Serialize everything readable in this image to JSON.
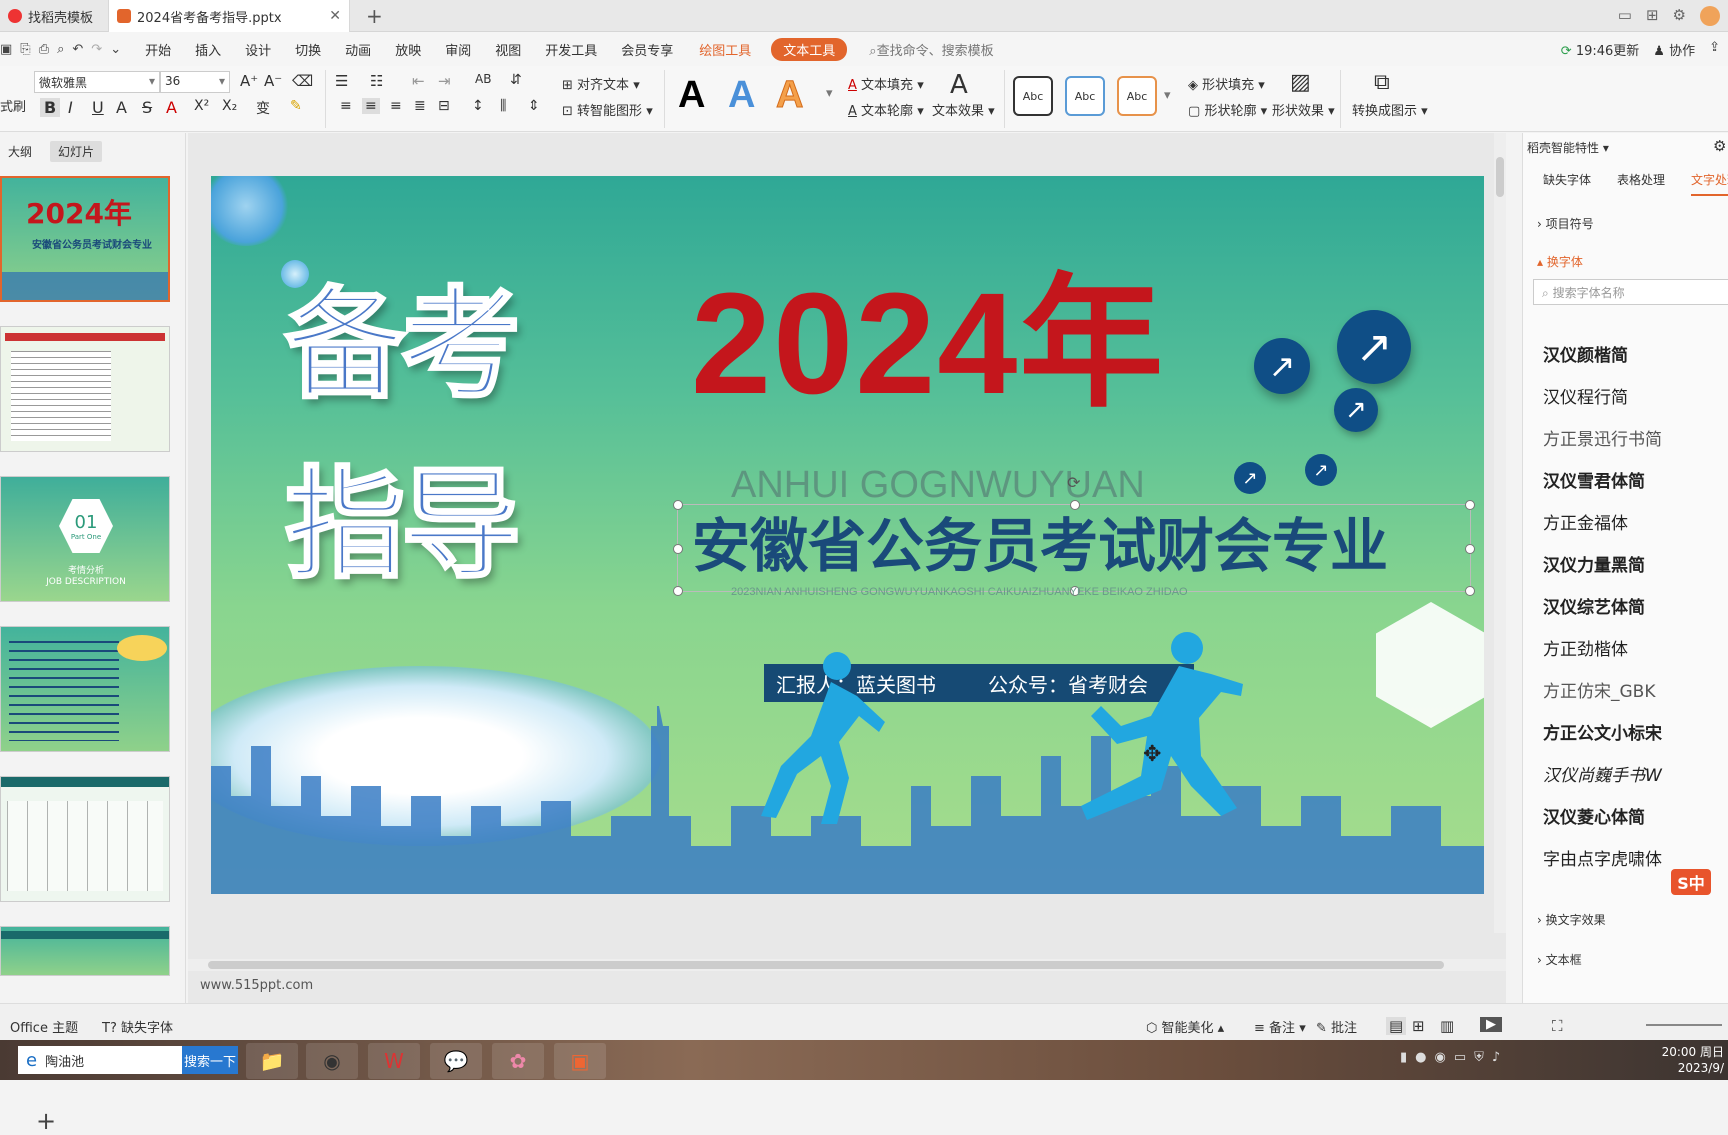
{
  "tabs": {
    "tab1": "找稻壳模板",
    "tab2": "2024省考备考指导.pptx"
  },
  "menu": {
    "items": [
      "开始",
      "插入",
      "设计",
      "切换",
      "动画",
      "放映",
      "审阅",
      "视图",
      "开发工具",
      "会员专享"
    ],
    "drawing_tools": "绘图工具",
    "text_tools": "文本工具",
    "search_placeholder": "查找命令、搜索模板",
    "update": "19:46更新",
    "collab": "协作"
  },
  "ribbon": {
    "brush": "式刷",
    "font_name": "微软雅黑",
    "font_size": "36",
    "align_text": "对齐文本",
    "smart_shape": "转智能图形",
    "text_fill": "文本填充",
    "text_outline": "文本轮廓",
    "text_effect": "文本效果",
    "abc": "Abc",
    "shape_fill": "形状填充",
    "shape_outline": "形状轮廓",
    "shape_effect": "形状效果",
    "convert_diagram": "转换成图示"
  },
  "left_panel": {
    "outline": "大纲",
    "slides": "幻灯片",
    "add": "+"
  },
  "slide": {
    "title1": "备考",
    "title2": "指导",
    "year": "2024年",
    "pinyin": "ANHUI GOGNWUYUAN",
    "subtitle": "安徽省公务员考试财会专业",
    "small_pinyin": "2023NIAN ANHUISHENG GONGWUYUANKAOSHI CAIKUAIZHUANYEKE BEIKAO ZHIDAO",
    "reporter": "汇报人：蓝关图书",
    "account": "公众号：省考财会",
    "colors": {
      "year": "#c4161c",
      "subtitle": "#1a4a7a",
      "title": "#4a78c8"
    }
  },
  "thumbs": {
    "t1_year": "2024年",
    "t1_sub": "安徽省公务员考试财会专业",
    "t3_num": "01",
    "t3_part": "Part One",
    "t3_cn": "考情分析",
    "t3_en": "JOB DESCRIPTION"
  },
  "side_panel": {
    "header": "稻壳智能特性",
    "tabs": [
      "缺失字体",
      "表格处理",
      "文字处理"
    ],
    "bullets": "项目符号",
    "change_font": "换字体",
    "search_placeholder": "搜索字体名称",
    "fonts": [
      "汉仪颜楷简",
      "汉仪程行简",
      "方正景迅行书简",
      "汉仪雪君体简",
      "方正金福体",
      "汉仪力量黑简",
      "汉仪综艺体简",
      "方正劲楷体",
      "方正仿宋_GBK",
      "方正公文小标宋",
      "汉仪尚巍手书W",
      "汉仪菱心体简",
      "字由点字虎啸体"
    ],
    "text_effect": "换文字效果",
    "textbox": "文本框"
  },
  "canvas": {
    "url": "www.515ppt.com"
  },
  "status": {
    "theme": "Office 主题",
    "missing_font": "缺失字体",
    "beautify": "智能美化",
    "notes": "备注",
    "comments": "批注"
  },
  "taskbar": {
    "search_text": "陶油池",
    "search_btn": "搜索一下",
    "time": "20:00 周日",
    "date": "2023/9/"
  }
}
